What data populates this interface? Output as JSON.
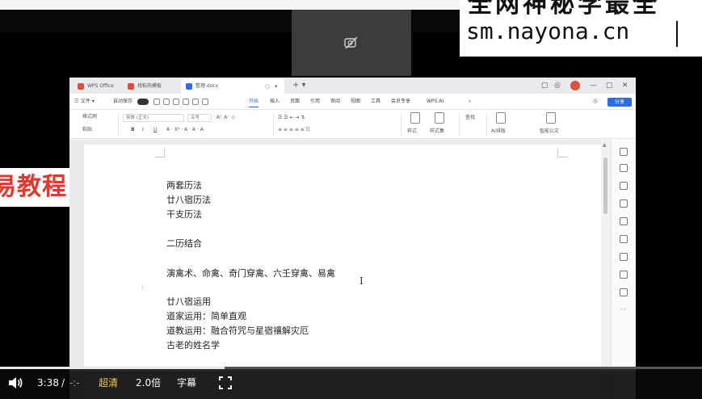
{
  "watermark": {
    "line1": "全网神秘学最全",
    "line2": "sm.nayona.cn"
  },
  "left_overlay": {
    "text": "易教程"
  },
  "wps": {
    "tabs": [
      {
        "label": "WPS Office",
        "color": "#e8493a"
      },
      {
        "label": "找稻壳模板",
        "color": "#e8493a"
      },
      {
        "label": "整理.docx",
        "color": "#2b6de8"
      }
    ],
    "menu": {
      "file": "三 文件 ▾",
      "autosave": "自动保存",
      "items": [
        "开始",
        "插入",
        "页面",
        "引用",
        "审阅",
        "视图",
        "工具",
        "会员专享"
      ],
      "active_item": "开始",
      "ai": "WPS AI",
      "share": "分享"
    },
    "ribbon": {
      "format_painter": "格式刷",
      "paste": "粘贴",
      "font_name": "宋体 (正文)",
      "font_size": "五号",
      "styles": "样式",
      "body_style": "样式集",
      "find": "查找",
      "ai_layout": "AI排版",
      "smart_doc": "智能公文"
    }
  },
  "document": {
    "lines": [
      "两套历法",
      "廿八宿历法",
      "干支历法",
      "二历结合",
      "演禽术、命禽、奇门穿禽、六壬穿禽、易禽",
      "廿八宿运用",
      "道家运用：简单直观",
      "道教运用：融合符咒与星宿禳解灾厄",
      "古老的姓名学"
    ]
  },
  "player": {
    "time": "3:38",
    "separator": "/",
    "duration": "-:-",
    "quality": "超清",
    "speed": "2.0倍",
    "subtitles": "字幕",
    "progress": 0.32
  },
  "colors": {
    "accent": "#2b6de8",
    "quality_gold": "#f1c84b",
    "overlay_red": "#e03a2e"
  }
}
